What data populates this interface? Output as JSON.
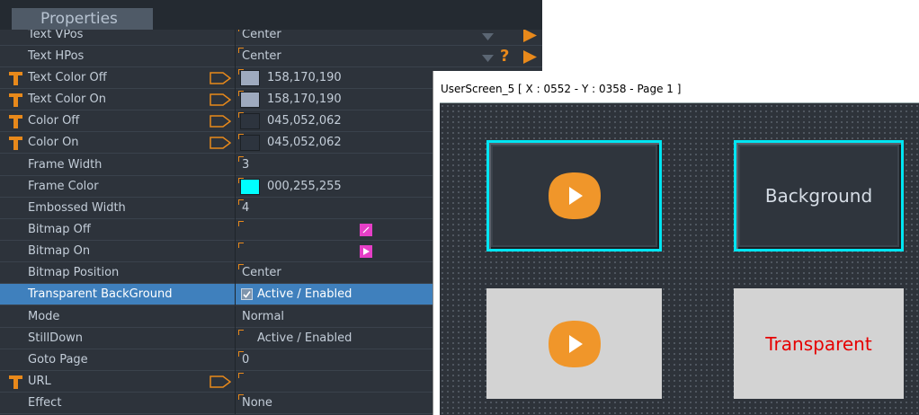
{
  "properties": {
    "tab_label": "Properties",
    "rows": [
      {
        "name": "Text VPos",
        "value": "Center"
      },
      {
        "name": "Text HPos",
        "value": "Center"
      },
      {
        "name": "Text Color Off",
        "value": "158,170,190",
        "swatch": "#9eaabe"
      },
      {
        "name": "Text Color On",
        "value": "158,170,190",
        "swatch": "#9eaabe"
      },
      {
        "name": "Color Off",
        "value": "045,052,062",
        "swatch": "#2d343e"
      },
      {
        "name": "Color On",
        "value": "045,052,062",
        "swatch": "#2d343e"
      },
      {
        "name": "Frame Width",
        "value": "3"
      },
      {
        "name": "Frame Color",
        "value": "000,255,255",
        "swatch": "#00ffff"
      },
      {
        "name": "Embossed Width",
        "value": "4"
      },
      {
        "name": "Bitmap Off",
        "value": ""
      },
      {
        "name": "Bitmap On",
        "value": ""
      },
      {
        "name": "Bitmap Position",
        "value": "Center"
      },
      {
        "name": "Transparent BackGround",
        "value": "Active / Enabled",
        "checked": true
      },
      {
        "name": "Mode",
        "value": "Normal"
      },
      {
        "name": "StillDown",
        "value": "Active / Enabled",
        "checked": false
      },
      {
        "name": "Goto Page",
        "value": "0"
      },
      {
        "name": "URL",
        "value": ""
      },
      {
        "name": "Effect",
        "value": "None"
      }
    ],
    "qm_label": "?"
  },
  "user_screen": {
    "title": "UserScreen_5 [ X : 0552 - Y : 0358 - Page 1 ]",
    "buttons": [
      {
        "id": "play-framed",
        "label": ""
      },
      {
        "id": "background",
        "label": "Background"
      },
      {
        "id": "play-transparent",
        "label": ""
      },
      {
        "id": "transparent",
        "label": "Transparent"
      }
    ]
  },
  "colors": {
    "accent_orange": "#e8891b",
    "frame_cyan": "#00e5f2",
    "selection_blue": "#3f80bd",
    "transparent_text": "#e60000",
    "bitmap_pink": "#e63fc7"
  }
}
